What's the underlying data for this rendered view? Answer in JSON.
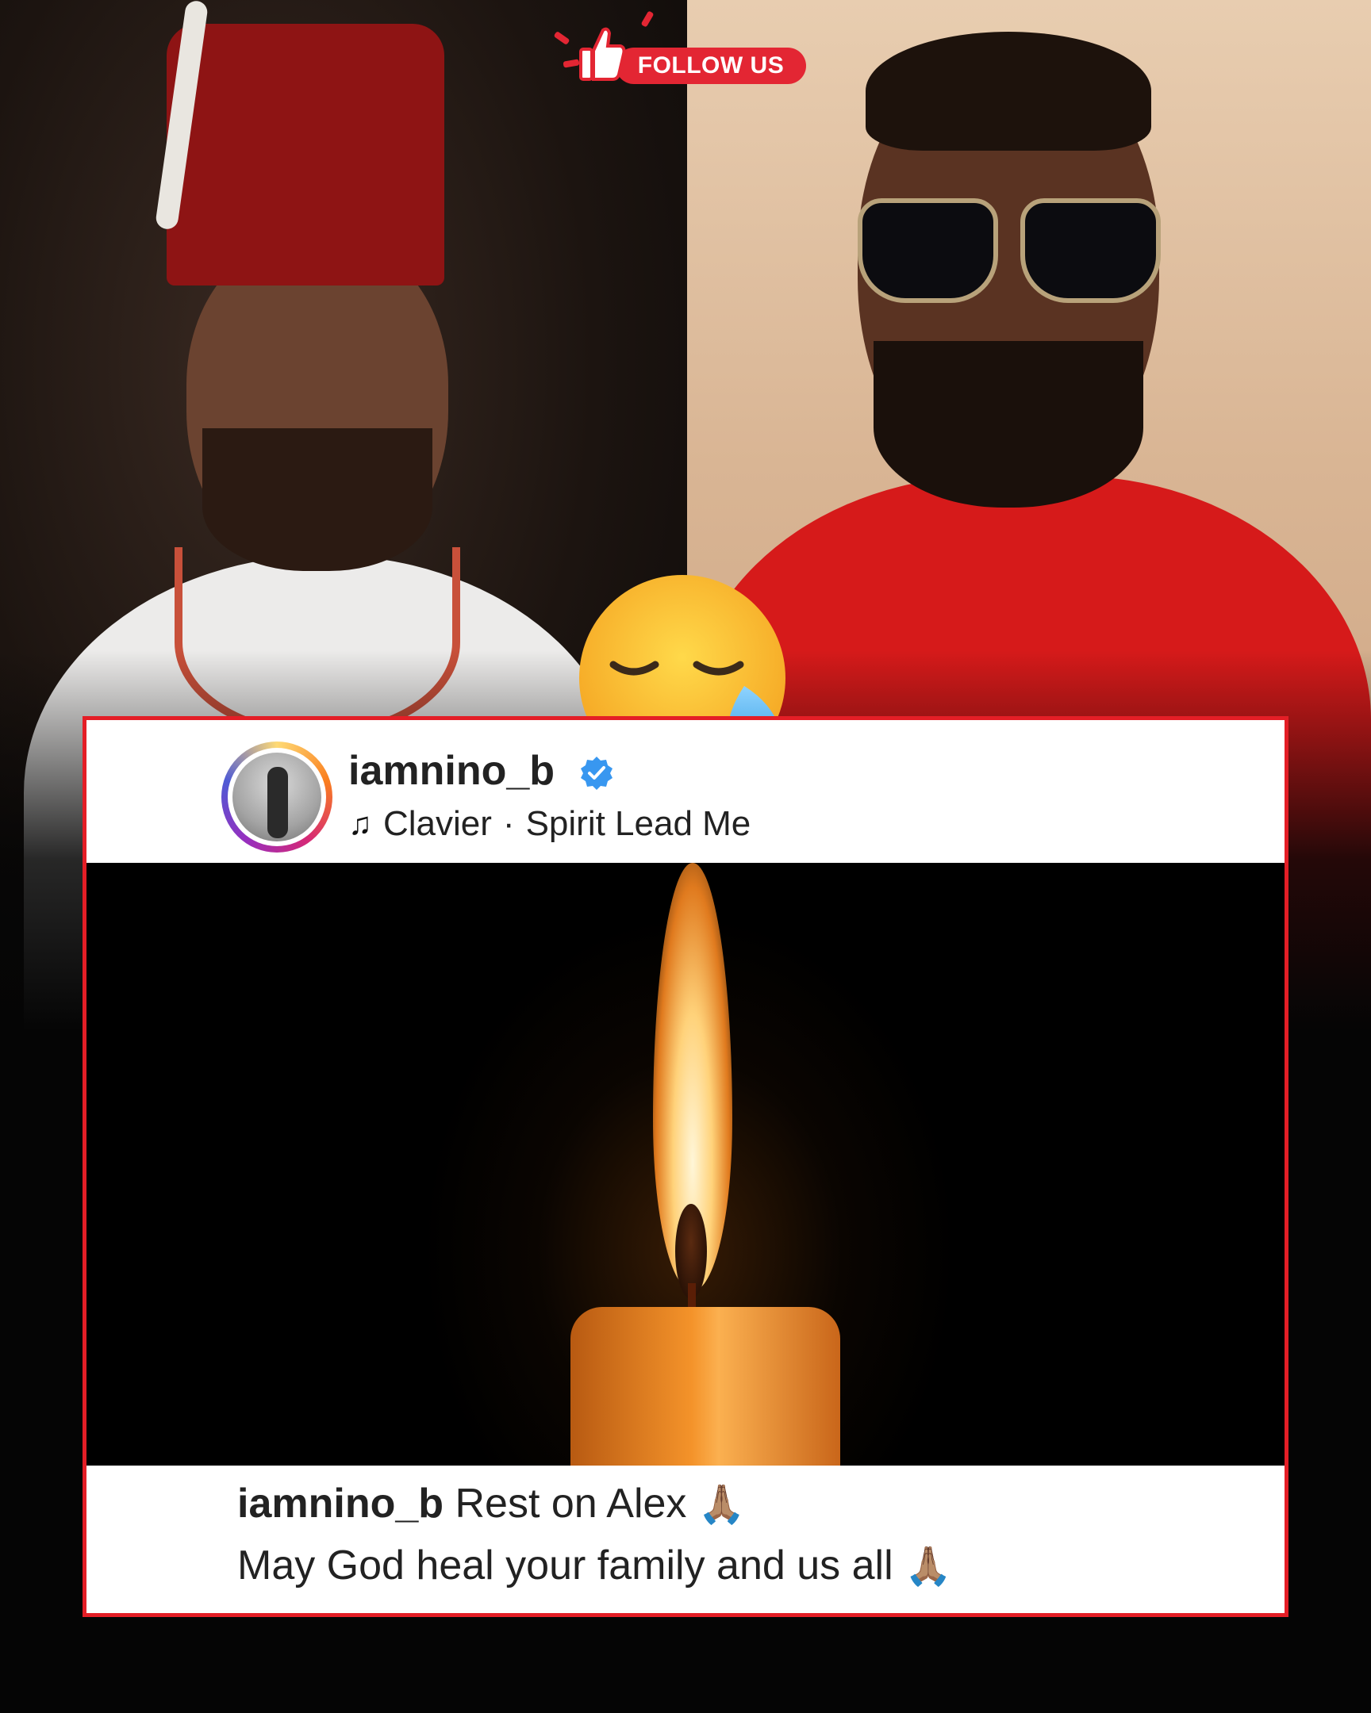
{
  "badge": {
    "follow_label": "FOLLOW US",
    "accent_color": "#e32633",
    "icon": "thumbs-up-icon"
  },
  "overlay_emoji": {
    "icon": "sad-relieved-face-icon",
    "glyph": "😥"
  },
  "post": {
    "border_color": "#e41e26",
    "username": "iamnino_b",
    "verified_icon": "verified-badge-icon",
    "audio": {
      "icon": "music-note-icon",
      "artist": "Clavier",
      "separator": "·",
      "track": "Spirit Lead Me"
    },
    "caption": {
      "username": "iamnino_b",
      "line1": "Rest on Alex",
      "line2": "May God heal your family and us all",
      "emoji": "🙏🏽"
    }
  }
}
